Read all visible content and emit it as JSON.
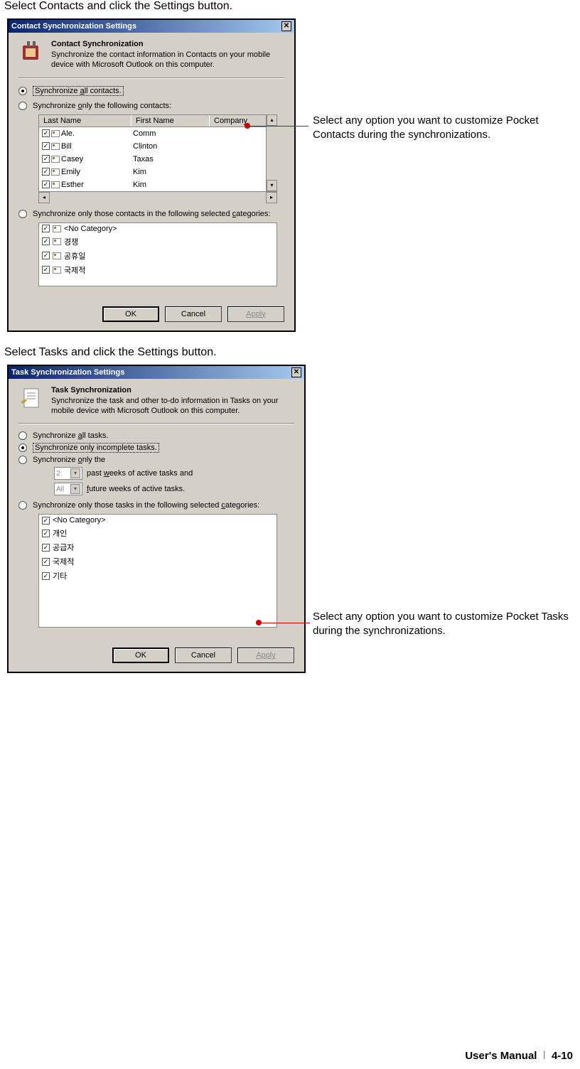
{
  "instruction1": "Select Contacts and click the Settings button.",
  "instruction2": "Select Tasks and click the Settings button.",
  "annot1": "Select any option you want to customize Pocket Contacts during the synchronizations.",
  "annot2": "Select any option you want to customize Pocket Tasks during the synchronizations.",
  "contactDlg": {
    "title": "Contact Synchronization Settings",
    "hdrTitle": "Contact Synchronization",
    "hdrDesc": "Synchronize the contact information in Contacts on your mobile device with Microsoft Outlook on this computer.",
    "opt1a": "Synchronize ",
    "opt1b": "a",
    "opt1c": "ll contacts.",
    "opt2a": "Synchronize ",
    "opt2b": "o",
    "opt2c": "nly the following contacts:",
    "th_ln": "Last Name",
    "th_fn": "First Name",
    "th_co": "Company",
    "rows": [
      {
        "ln": "Ale.",
        "fn": "Comm"
      },
      {
        "ln": "Bill",
        "fn": "Clinton"
      },
      {
        "ln": "Casey",
        "fn": "Taxas"
      },
      {
        "ln": "Emily",
        "fn": "Kim"
      },
      {
        "ln": "Esther",
        "fn": "Kim"
      }
    ],
    "opt3a": "Synchronize only those contacts in the following selected ",
    "opt3b": "c",
    "opt3c": "ategories:",
    "cats": [
      "<No Category>",
      "경쟁",
      "공휴일",
      "국제적"
    ],
    "ok": "OK",
    "cancel": "Cancel",
    "apply": "Apply"
  },
  "taskDlg": {
    "title": "Task Synchronization Settings",
    "hdrTitle": "Task Synchronization",
    "hdrDesc": "Synchronize the task and other to-do information in Tasks on your mobile device with Microsoft Outlook on this computer.",
    "opt1a": "Synchronize ",
    "opt1b": "a",
    "opt1c": "ll tasks.",
    "opt2": "Synchronize only incomplete tasks.",
    "opt3a": "Synchronize ",
    "opt3b": "o",
    "opt3c": "nly the",
    "pastVal": "2",
    "pastLabelA": "past ",
    "pastLabelB": "w",
    "pastLabelC": "eeks of active tasks and",
    "futVal": "All",
    "futLabelA": "f",
    "futLabelB": "uture weeks of active tasks.",
    "opt4a": "Synchronize only those tasks in the following selected ",
    "opt4b": "c",
    "opt4c": "ategories:",
    "cats": [
      "<No Category>",
      "개인",
      "공급자",
      "국제적",
      "기타"
    ],
    "ok": "OK",
    "cancel": "Cancel",
    "apply": "Apply"
  },
  "footer": {
    "manual": "User's Manual",
    "sep": "ⅼ",
    "page": "4-10"
  }
}
